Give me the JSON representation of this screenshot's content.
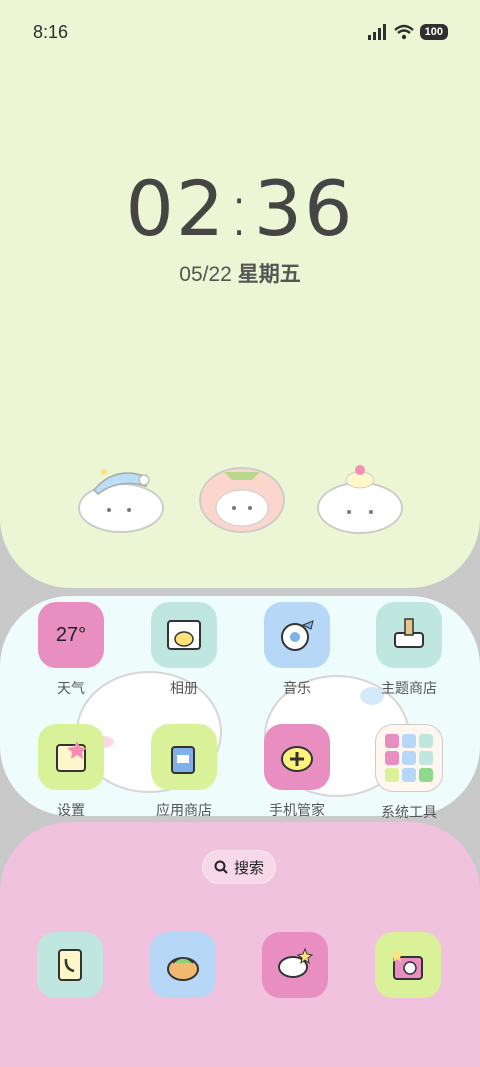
{
  "status": {
    "time": "8:16",
    "battery": "100"
  },
  "lockclock": {
    "hours": "02",
    "minutes": "36",
    "date": "05/22",
    "weekday": "星期五"
  },
  "apps": [
    {
      "label": "天气",
      "value": "27°",
      "icon": "weather-icon",
      "color": "#e88ec0"
    },
    {
      "label": "相册",
      "icon": "gallery-icon",
      "color": "#bfe6df"
    },
    {
      "label": "音乐",
      "icon": "music-icon",
      "color": "#b7d7f7"
    },
    {
      "label": "主题商店",
      "icon": "theme-store-icon",
      "color": "#bfe6df"
    },
    {
      "label": "设置",
      "icon": "settings-icon",
      "color": "#d9f29a"
    },
    {
      "label": "应用商店",
      "icon": "app-store-icon",
      "color": "#d9f29a"
    },
    {
      "label": "手机管家",
      "icon": "security-icon",
      "color": "#e88ec0"
    },
    {
      "label": "系统工具",
      "icon": "system-tools-folder-icon",
      "color": "#fff6f0"
    }
  ],
  "search": {
    "label": "搜索"
  },
  "dock": [
    {
      "icon": "phone-icon",
      "color": "#bfe6df"
    },
    {
      "icon": "contacts-icon",
      "color": "#b7d7f7"
    },
    {
      "icon": "messages-icon",
      "color": "#e88ec0"
    },
    {
      "icon": "camera-icon",
      "color": "#d9f29a"
    }
  ]
}
